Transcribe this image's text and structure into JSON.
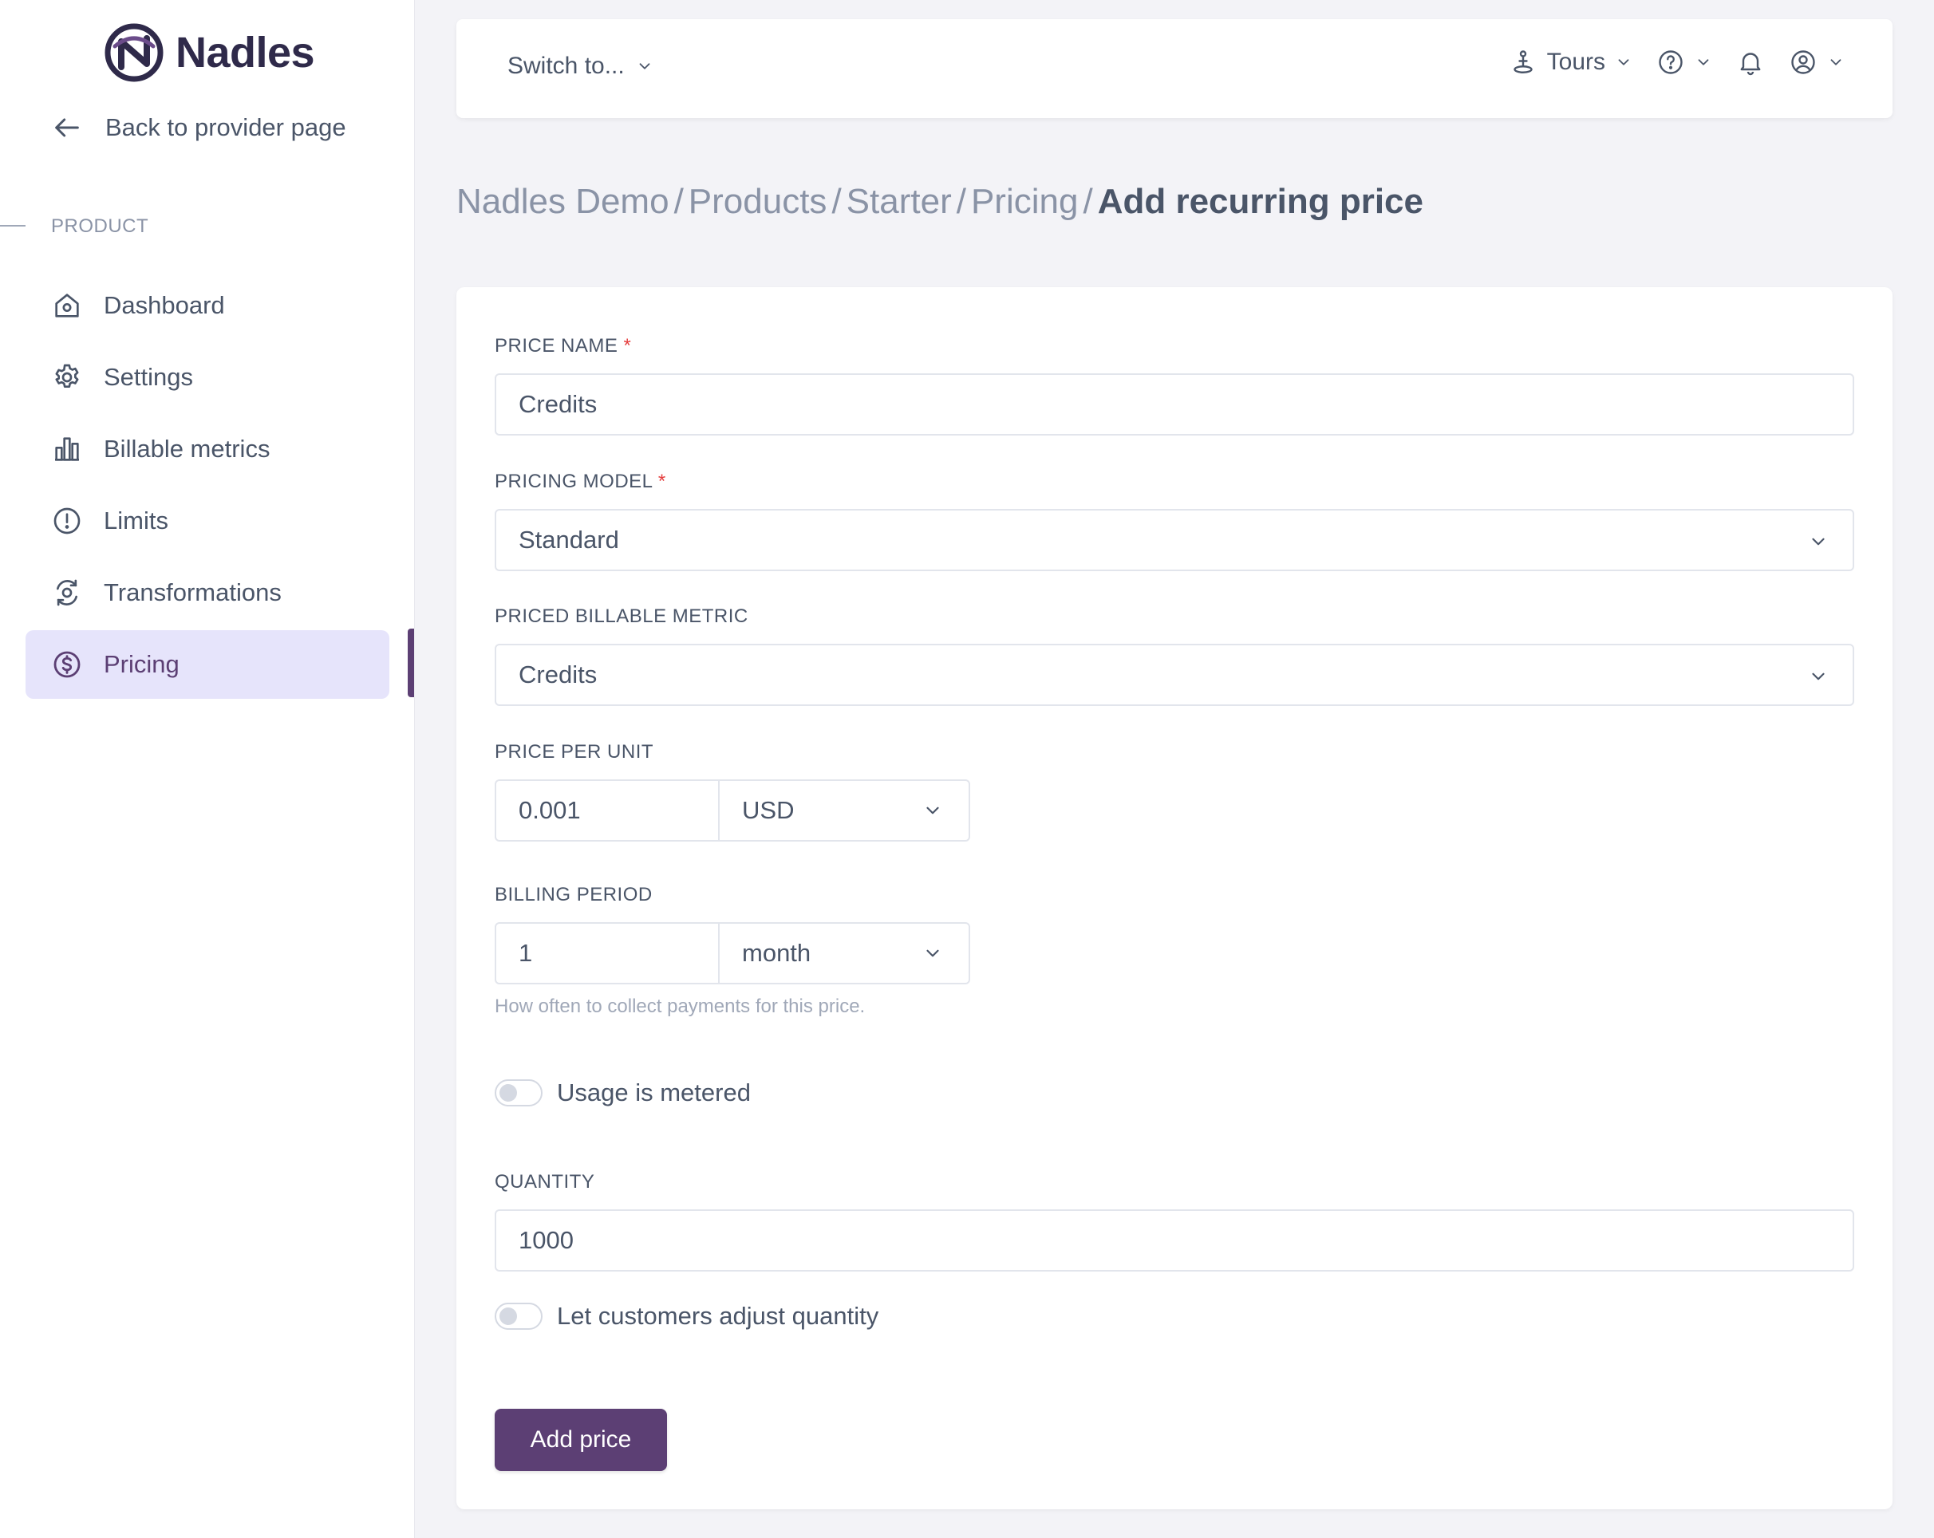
{
  "app": {
    "name": "Nadles",
    "brand_color": "#5c3f74"
  },
  "sidebar": {
    "back_label": "Back to provider page",
    "section_label": "PRODUCT",
    "items": [
      {
        "label": "Dashboard",
        "icon": "home-icon",
        "active": false
      },
      {
        "label": "Settings",
        "icon": "gear-icon",
        "active": false
      },
      {
        "label": "Billable metrics",
        "icon": "bar-chart-icon",
        "active": false
      },
      {
        "label": "Limits",
        "icon": "alert-circle-icon",
        "active": false
      },
      {
        "label": "Transformations",
        "icon": "transform-icon",
        "active": false
      },
      {
        "label": "Pricing",
        "icon": "dollar-circle-icon",
        "active": true
      }
    ]
  },
  "topbar": {
    "switch_label": "Switch to...",
    "tours_label": "Tours"
  },
  "breadcrumb": {
    "items": [
      "Nadles Demo",
      "Products",
      "Starter",
      "Pricing"
    ],
    "current": "Add recurring price"
  },
  "form": {
    "price_name": {
      "label": "PRICE NAME",
      "required": "*",
      "value": "Credits"
    },
    "pricing_model": {
      "label": "PRICING MODEL",
      "required": "*",
      "value": "Standard"
    },
    "priced_metric": {
      "label": "PRICED BILLABLE METRIC",
      "value": "Credits"
    },
    "price_per_unit": {
      "label": "PRICE PER UNIT",
      "value": "0.001",
      "currency": "USD"
    },
    "billing_period": {
      "label": "BILLING PERIOD",
      "value": "1",
      "unit": "month",
      "help": "How often to collect payments for this price."
    },
    "metered_toggle": {
      "label": "Usage is metered",
      "on": false
    },
    "quantity": {
      "label": "QUANTITY",
      "value": "1000"
    },
    "adjust_toggle": {
      "label": "Let customers adjust quantity",
      "on": false
    },
    "submit_label": "Add price"
  }
}
